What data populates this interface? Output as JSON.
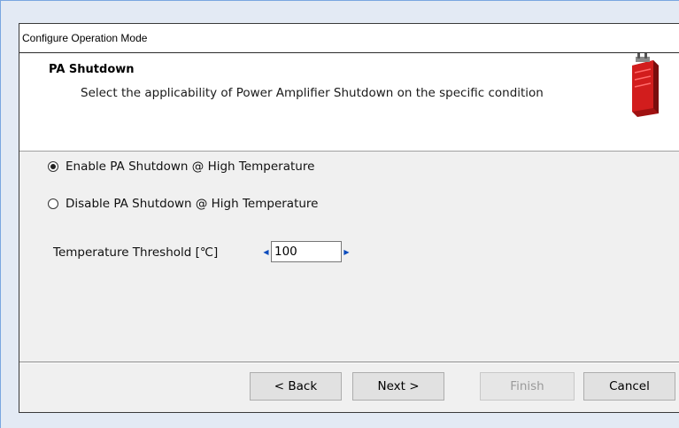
{
  "window": {
    "title": "Configure Operation Mode"
  },
  "banner": {
    "title": "PA Shutdown",
    "description": "Select the applicability of Power Amplifier Shutdown on the specific condition",
    "icon": "red-device-icon"
  },
  "options": {
    "enable": {
      "label": "Enable PA Shutdown @ High Temperature",
      "selected": true
    },
    "disable": {
      "label": "Disable PA Shutdown @ High Temperature",
      "selected": false
    }
  },
  "threshold": {
    "label": "Temperature Threshold [℃]",
    "value": "100"
  },
  "buttons": {
    "back": "< Back",
    "next": "Next >",
    "finish": "Finish",
    "cancel": "Cancel"
  },
  "colors": {
    "accent_arrow": "#0a4bbd",
    "icon_red": "#d21d1d"
  }
}
